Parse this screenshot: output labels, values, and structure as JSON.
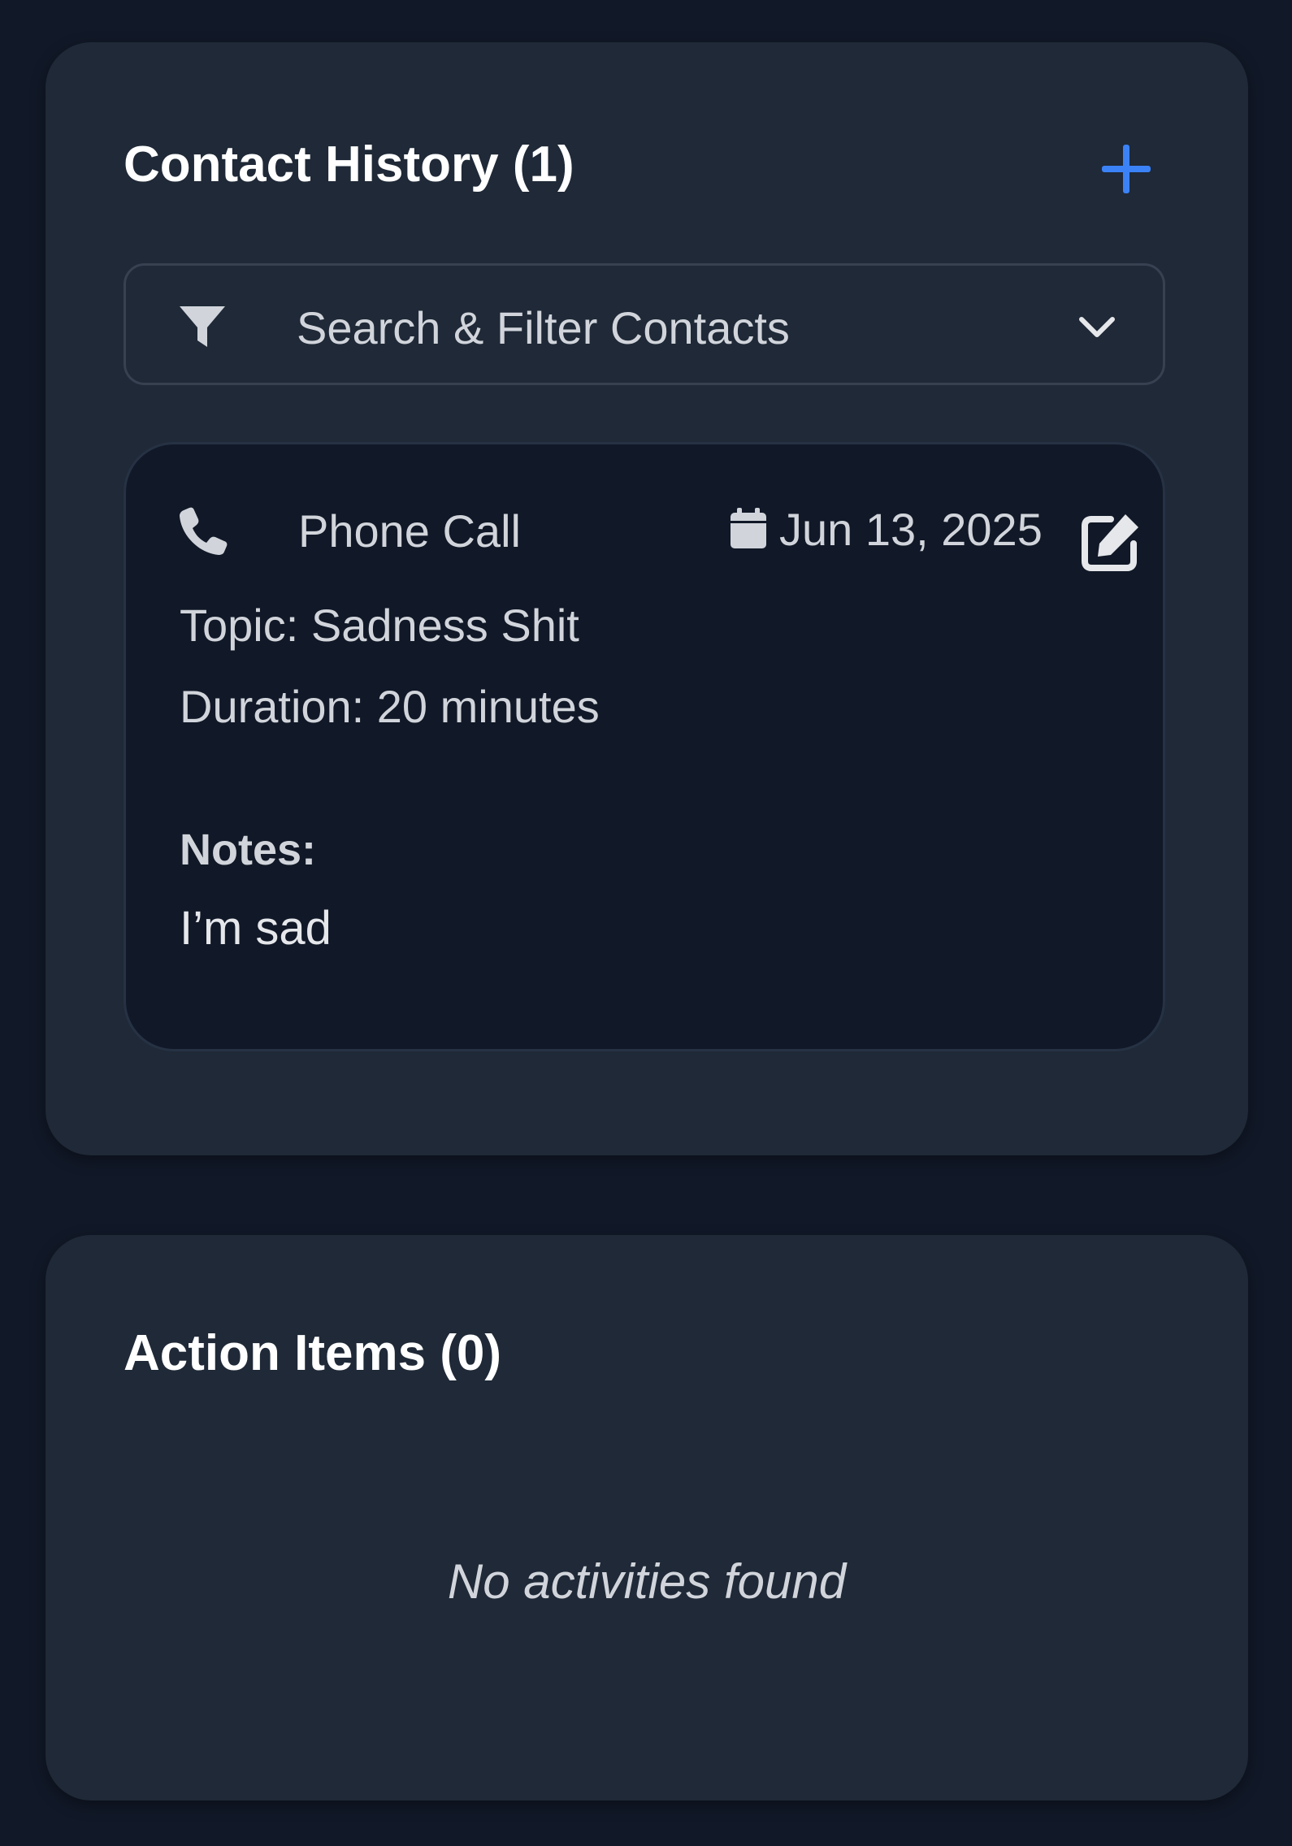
{
  "contact_history": {
    "title": "Contact History (1)",
    "add_icon": "plus-icon",
    "accent_color": "#3b82f6",
    "filter": {
      "icon": "filter-icon",
      "label": "Search & Filter Contacts",
      "toggle_icon": "chevron-down-icon"
    },
    "contacts": [
      {
        "type_icon": "phone-icon",
        "type": "Phone Call",
        "date_icon": "calendar-icon",
        "date": "Jun 13, 2025",
        "edit_icon": "edit-icon",
        "topic": "Topic: Sadness Shit",
        "duration": "Duration: 20 minutes",
        "notes_label": "Notes:",
        "notes": "I’m sad"
      }
    ]
  },
  "action_items": {
    "title": "Action Items (0)",
    "empty_text": "No activities found"
  }
}
